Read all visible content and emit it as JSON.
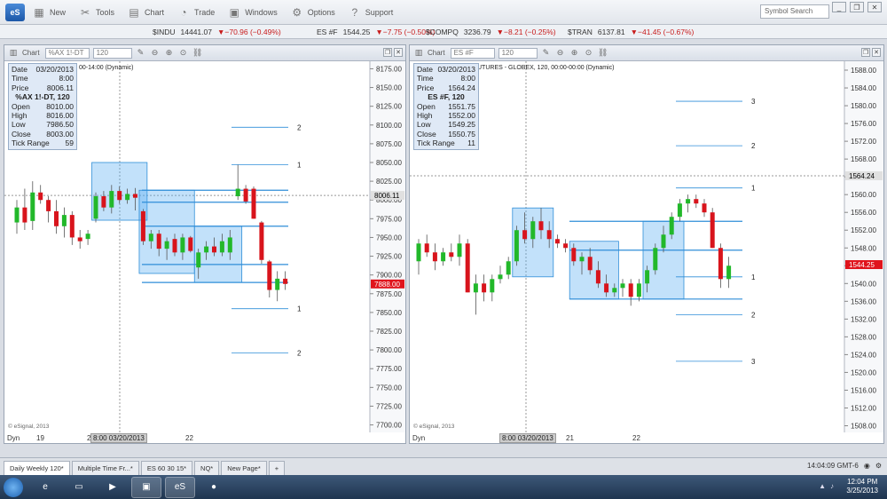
{
  "toolbar": {
    "logo": "eS",
    "buttons": [
      {
        "label": "New",
        "icon": "new-icon"
      },
      {
        "label": "Tools",
        "icon": "tools-icon"
      },
      {
        "label": "Chart",
        "icon": "chart-icon"
      },
      {
        "label": "Trade",
        "icon": "trade-icon"
      },
      {
        "label": "Windows",
        "icon": "windows-icon"
      },
      {
        "label": "Options",
        "icon": "gear-icon"
      },
      {
        "label": "Support",
        "icon": "help-icon"
      }
    ],
    "symbol_search_placeholder": "Symbol Search"
  },
  "ticker": [
    {
      "name": "$INDU",
      "price": "14441.07",
      "change": "▼−70.96 (−0.49%)"
    },
    {
      "name": "ES #F",
      "price": "1544.25",
      "change": "▼−7.75 (−0.50%)"
    },
    {
      "name": "$COMPQ",
      "price": "3236.79",
      "change": "▼−8.21 (−0.25%)"
    },
    {
      "name": "$TRAN",
      "price": "6137.81",
      "change": "▼−41.45 (−0.67%)"
    }
  ],
  "left_chart": {
    "header_label": "Chart",
    "symbol": "%AX 1!-DT",
    "interval": "120",
    "study_label": "00-14:00 (Dynamic)",
    "databox": {
      "date_label": "Date",
      "date": "03/20/2013",
      "time_label": "Time",
      "time": "8:00",
      "price_label": "Price",
      "price": "8006.11",
      "heading": "%AX 1!-DT, 120",
      "open_label": "Open",
      "open": "8010.00",
      "high_label": "High",
      "high": "8016.00",
      "low_label": "Low",
      "low": "7986.50",
      "close_label": "Close",
      "close": "8003.00",
      "tick_label": "Tick Range",
      "tick": "59"
    },
    "copyright": "© eSignal, 2013",
    "dyn": "Dyn",
    "x_labels": [
      {
        "text": "19"
      },
      {
        "text": "2"
      },
      {
        "text": "22"
      }
    ],
    "cursor_time": "8:00 03/20/2013",
    "price_tag": "8006.11",
    "last_tag": "7888.00"
  },
  "right_chart": {
    "header_label": "Chart",
    "symbol": "ES #F",
    "interval": "120",
    "study_label": "UTURES - GLOBEX, 120, 00:00-00:00 (Dynamic)",
    "databox": {
      "date_label": "Date",
      "date": "03/20/2013",
      "time_label": "Time",
      "time": "8:00",
      "price_label": "Price",
      "price": "1564.24",
      "heading": "ES #F, 120",
      "open_label": "Open",
      "open": "1551.75",
      "high_label": "High",
      "high": "1552.00",
      "low_label": "Low",
      "low": "1549.25",
      "close_label": "Close",
      "close": "1550.75",
      "tick_label": "Tick Range",
      "tick": "11"
    },
    "copyright": "© eSignal, 2013",
    "dyn": "Dyn",
    "x_labels": [
      {
        "text": "21"
      },
      {
        "text": "22"
      }
    ],
    "cursor_time": "8:00 03/20/2013",
    "price_tag": "1564.24",
    "last_tag": "1544.25"
  },
  "tabs": [
    "Daily Weekly 120*",
    "Multiple Time Fr...*",
    "ES 60 30 15*",
    "NQ*",
    "New Page*",
    "+"
  ],
  "status_time": "14:04:09 GMT-6",
  "clock": {
    "time": "12:04 PM",
    "date": "3/25/2013"
  },
  "chart_data": [
    {
      "type": "candlestick",
      "title": "%AX 1!-DT, 120",
      "y_ticks": [
        8175,
        8150,
        8125,
        8100,
        8075,
        8050,
        8025,
        8000,
        7975,
        7950,
        7925,
        7900,
        7875,
        7850,
        7825,
        7800,
        7775,
        7750,
        7725,
        7700
      ],
      "ylim": [
        7690,
        8185
      ],
      "candles": [
        {
          "o": 7970,
          "h": 8000,
          "l": 7955,
          "c": 7990
        },
        {
          "o": 7990,
          "h": 8015,
          "l": 7960,
          "c": 7970
        },
        {
          "o": 7972,
          "h": 8025,
          "l": 7960,
          "c": 8010
        },
        {
          "o": 8010,
          "h": 8020,
          "l": 7995,
          "c": 8000
        },
        {
          "o": 8000,
          "h": 8005,
          "l": 7970,
          "c": 7985
        },
        {
          "o": 7985,
          "h": 8000,
          "l": 7955,
          "c": 7965
        },
        {
          "o": 7965,
          "h": 7990,
          "l": 7950,
          "c": 7980
        },
        {
          "o": 7980,
          "h": 7985,
          "l": 7940,
          "c": 7950
        },
        {
          "o": 7950,
          "h": 7960,
          "l": 7935,
          "c": 7945
        },
        {
          "o": 7948,
          "h": 7960,
          "l": 7940,
          "c": 7955
        },
        {
          "o": 7975,
          "h": 8010,
          "l": 7970,
          "c": 8005
        },
        {
          "o": 8005,
          "h": 8012,
          "l": 7985,
          "c": 7990
        },
        {
          "o": 7990,
          "h": 8020,
          "l": 7982,
          "c": 8012
        },
        {
          "o": 8012,
          "h": 8018,
          "l": 7995,
          "c": 8000
        },
        {
          "o": 8000,
          "h": 8015,
          "l": 7995,
          "c": 8008
        },
        {
          "o": 8008,
          "h": 8016,
          "l": 7986,
          "c": 8003
        },
        {
          "o": 7985,
          "h": 7988,
          "l": 7940,
          "c": 7945
        },
        {
          "o": 7945,
          "h": 7960,
          "l": 7935,
          "c": 7955
        },
        {
          "o": 7955,
          "h": 7960,
          "l": 7925,
          "c": 7935
        },
        {
          "o": 7935,
          "h": 7950,
          "l": 7920,
          "c": 7945
        },
        {
          "o": 7948,
          "h": 7955,
          "l": 7925,
          "c": 7930
        },
        {
          "o": 7930,
          "h": 7955,
          "l": 7920,
          "c": 7950
        },
        {
          "o": 7950,
          "h": 7952,
          "l": 7930,
          "c": 7932
        },
        {
          "o": 7910,
          "h": 7935,
          "l": 7895,
          "c": 7930
        },
        {
          "o": 7930,
          "h": 7945,
          "l": 7920,
          "c": 7938
        },
        {
          "o": 7938,
          "h": 7950,
          "l": 7925,
          "c": 7930
        },
        {
          "o": 7930,
          "h": 7955,
          "l": 7925,
          "c": 7945
        },
        {
          "o": 7930,
          "h": 7960,
          "l": 7920,
          "c": 7950
        },
        {
          "o": 8005,
          "h": 8047,
          "l": 8000,
          "c": 8015
        },
        {
          "o": 8015,
          "h": 8020,
          "l": 7995,
          "c": 7998
        },
        {
          "o": 8015,
          "h": 8018,
          "l": 7975,
          "c": 7975
        },
        {
          "o": 7970,
          "h": 7972,
          "l": 7915,
          "c": 7920
        },
        {
          "o": 7918,
          "h": 7920,
          "l": 7870,
          "c": 7880
        },
        {
          "o": 7880,
          "h": 7905,
          "l": 7865,
          "c": 7895
        },
        {
          "o": 7895,
          "h": 7905,
          "l": 7880,
          "c": 7888
        }
      ],
      "levels": [
        {
          "price": 8097,
          "label": "2"
        },
        {
          "price": 8047,
          "label": "1"
        },
        {
          "price": 8013
        },
        {
          "price": 7997
        },
        {
          "price": 7965
        },
        {
          "price": 7914
        },
        {
          "price": 7890
        },
        {
          "price": 7855,
          "label": "1"
        },
        {
          "price": 7796,
          "label": "2"
        }
      ]
    },
    {
      "type": "candlestick",
      "title": "ES #F, 120",
      "y_ticks": [
        1588,
        1584,
        1580,
        1576,
        1572,
        1568,
        1564,
        1560,
        1556,
        1552,
        1548,
        1544,
        1540,
        1536,
        1532,
        1528,
        1524,
        1520,
        1516,
        1512,
        1508
      ],
      "ylim": [
        1506.5,
        1590
      ],
      "candles": [
        {
          "o": 1545,
          "h": 1550,
          "l": 1542,
          "c": 1549
        },
        {
          "o": 1549,
          "h": 1551,
          "l": 1546,
          "c": 1547
        },
        {
          "o": 1547,
          "h": 1549,
          "l": 1543,
          "c": 1545
        },
        {
          "o": 1545,
          "h": 1548,
          "l": 1544,
          "c": 1547
        },
        {
          "o": 1547,
          "h": 1549,
          "l": 1545,
          "c": 1546
        },
        {
          "o": 1546,
          "h": 1551,
          "l": 1544,
          "c": 1549
        },
        {
          "o": 1549,
          "h": 1550,
          "l": 1538,
          "c": 1538
        },
        {
          "o": 1538,
          "h": 1542,
          "l": 1533,
          "c": 1540
        },
        {
          "o": 1540,
          "h": 1542,
          "l": 1536,
          "c": 1538
        },
        {
          "o": 1538,
          "h": 1542,
          "l": 1536,
          "c": 1541
        },
        {
          "o": 1541,
          "h": 1544,
          "l": 1540,
          "c": 1542
        },
        {
          "o": 1542,
          "h": 1546,
          "l": 1541,
          "c": 1545
        },
        {
          "o": 1545,
          "h": 1553,
          "l": 1544,
          "c": 1552
        },
        {
          "o": 1552,
          "h": 1556,
          "l": 1549,
          "c": 1550
        },
        {
          "o": 1550,
          "h": 1555,
          "l": 1548,
          "c": 1554
        },
        {
          "o": 1554,
          "h": 1557,
          "l": 1550,
          "c": 1552
        },
        {
          "o": 1552,
          "h": 1554,
          "l": 1548,
          "c": 1550
        },
        {
          "o": 1550,
          "h": 1551,
          "l": 1548,
          "c": 1549
        },
        {
          "o": 1549,
          "h": 1550,
          "l": 1547,
          "c": 1548
        },
        {
          "o": 1548,
          "h": 1549,
          "l": 1544,
          "c": 1545
        },
        {
          "o": 1545,
          "h": 1547,
          "l": 1542,
          "c": 1546
        },
        {
          "o": 1546,
          "h": 1548,
          "l": 1542,
          "c": 1543
        },
        {
          "o": 1543,
          "h": 1545,
          "l": 1539,
          "c": 1540
        },
        {
          "o": 1540,
          "h": 1542,
          "l": 1537,
          "c": 1538
        },
        {
          "o": 1538,
          "h": 1540,
          "l": 1537,
          "c": 1539
        },
        {
          "o": 1539,
          "h": 1541,
          "l": 1537,
          "c": 1540
        },
        {
          "o": 1540,
          "h": 1541,
          "l": 1535,
          "c": 1537
        },
        {
          "o": 1537,
          "h": 1541,
          "l": 1536,
          "c": 1540
        },
        {
          "o": 1540,
          "h": 1544,
          "l": 1538,
          "c": 1543
        },
        {
          "o": 1543,
          "h": 1549,
          "l": 1542,
          "c": 1548
        },
        {
          "o": 1548,
          "h": 1553,
          "l": 1547,
          "c": 1551
        },
        {
          "o": 1551,
          "h": 1556,
          "l": 1550,
          "c": 1555
        },
        {
          "o": 1555,
          "h": 1559,
          "l": 1554,
          "c": 1558
        },
        {
          "o": 1558,
          "h": 1560,
          "l": 1556,
          "c": 1559
        },
        {
          "o": 1559,
          "h": 1560,
          "l": 1557,
          "c": 1558
        },
        {
          "o": 1558,
          "h": 1559,
          "l": 1555,
          "c": 1556
        },
        {
          "o": 1556,
          "h": 1557,
          "l": 1548,
          "c": 1548
        },
        {
          "o": 1548,
          "h": 1549,
          "l": 1539,
          "c": 1541
        },
        {
          "o": 1541,
          "h": 1546,
          "l": 1539,
          "c": 1544
        }
      ],
      "levels": [
        {
          "price": 1581,
          "label": "3"
        },
        {
          "price": 1571,
          "label": "2"
        },
        {
          "price": 1561.5,
          "label": "1"
        },
        {
          "price": 1554
        },
        {
          "price": 1547.5
        },
        {
          "price": 1541.5,
          "label": "1"
        },
        {
          "price": 1536.5
        },
        {
          "price": 1533,
          "label": "2"
        },
        {
          "price": 1522.5,
          "label": "3"
        }
      ]
    }
  ]
}
